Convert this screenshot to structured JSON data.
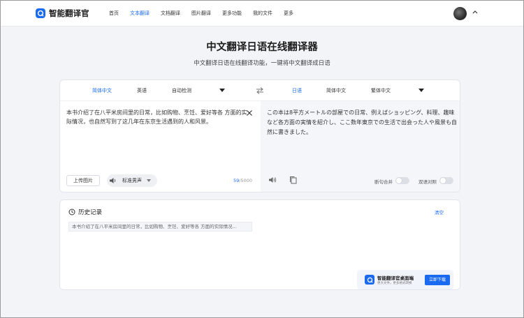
{
  "brand": {
    "name": "智能翻译官",
    "color": "#1a6bf0"
  },
  "nav": {
    "items": [
      {
        "label": "首页",
        "active": false
      },
      {
        "label": "文本翻译",
        "active": true
      },
      {
        "label": "文档翻译",
        "active": false
      },
      {
        "label": "图片翻译",
        "active": false
      },
      {
        "label": "更多功能",
        "active": false
      },
      {
        "label": "我的文件",
        "active": false
      },
      {
        "label": "更多",
        "active": false
      }
    ]
  },
  "page": {
    "title": "中文翻译日语在线翻译器",
    "subtitle": "中文翻译日语在线翻译功能，一键将中文翻译成日语"
  },
  "translator": {
    "source_langs": [
      "简体中文",
      "英语",
      "自动检测"
    ],
    "target_langs": [
      "日语",
      "简体中文",
      "繁体中文"
    ],
    "source_text": "本书介绍了在八平米房间里的日常，比如购物、烹饪、爱好等各 方面的实际情况，也自然写到了这几年在东京生活遇到的人和风景。",
    "target_text": "この本は8平方メートルの部屋での日常、例えばショッピング、料理、趣味など各方面の実情を紹介し、ここ数年東京での生活で出会った人や風景も自然に書きました。",
    "upload_label": "上传图片",
    "voice_label": "标准男声",
    "char_count": "59",
    "char_limit": "/5000",
    "toggle_merge": "断句合并",
    "toggle_bilingual": "双语对照"
  },
  "history": {
    "title": "历史记录",
    "clear_label": "清空",
    "items": [
      "本书介绍了在八平米房间里的日常，比如购物、烹饪、爱好等各 方面的实际情况..."
    ]
  },
  "promo": {
    "title": "智能翻译官桌面端",
    "subtitle": "更大文件，更多格式转换",
    "button": "立即下载"
  },
  "icons": {
    "logo": "translator-logo-icon",
    "caret": "chevron-up-icon",
    "swap": "swap-icon",
    "close": "close-icon",
    "speaker": "speaker-icon",
    "copy": "copy-icon",
    "history": "history-icon"
  }
}
